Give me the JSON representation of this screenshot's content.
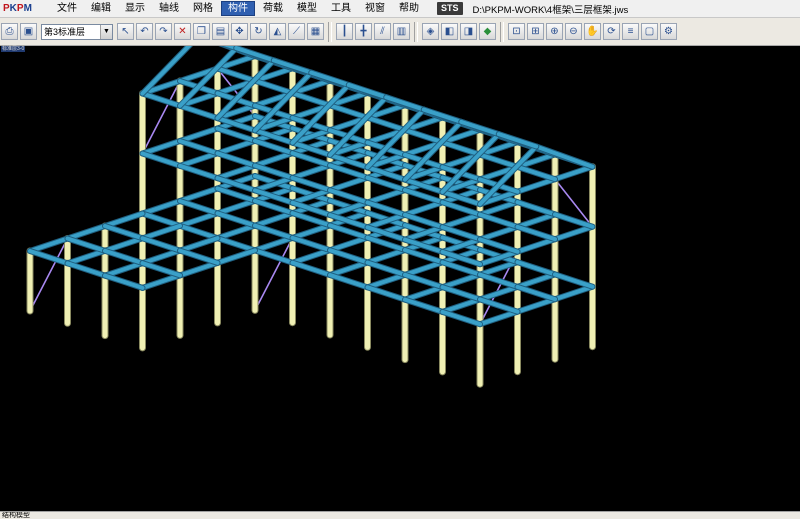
{
  "app": {
    "logo_text": "PKPM",
    "sts_badge": "STS",
    "file_path": "D:\\PKPM-WORK\\4框架\\三层框架.jws"
  },
  "menu": {
    "items": [
      {
        "label": "文件",
        "active": false
      },
      {
        "label": "编辑",
        "active": false
      },
      {
        "label": "显示",
        "active": false
      },
      {
        "label": "轴线",
        "active": false
      },
      {
        "label": "网格",
        "active": false
      },
      {
        "label": "构件",
        "active": true
      },
      {
        "label": "荷载",
        "active": false
      },
      {
        "label": "模型",
        "active": false
      },
      {
        "label": "工具",
        "active": false
      },
      {
        "label": "视窗",
        "active": false
      },
      {
        "label": "帮助",
        "active": false
      }
    ]
  },
  "toolbar": {
    "floor_select_value": "第3标准层",
    "icons": [
      "print-icon",
      "save-icon",
      "select-arrow-icon",
      "undo-icon",
      "redo-icon",
      "delete-icon",
      "copy-icon",
      "paste-icon",
      "move-icon",
      "rotate-icon",
      "mirror-icon",
      "measure-icon",
      "property-icon",
      "column-icon",
      "beam-icon",
      "brace-icon",
      "wall-icon",
      "view-3d-icon",
      "view-front-icon",
      "view-side-icon",
      "render-icon",
      "zoom-window-icon",
      "zoom-all-icon",
      "zoom-in-icon",
      "zoom-out-icon",
      "pan-icon",
      "refresh-icon",
      "layer-icon",
      "display-icon",
      "settings-icon"
    ]
  },
  "viewport": {
    "tag": "标准层3-0",
    "colors": {
      "background": "#000000",
      "beam": "#3aa0c8",
      "column": "#f0f0b4",
      "brace": "#a888f0"
    }
  },
  "statusbar": {
    "text": "结构模型"
  }
}
